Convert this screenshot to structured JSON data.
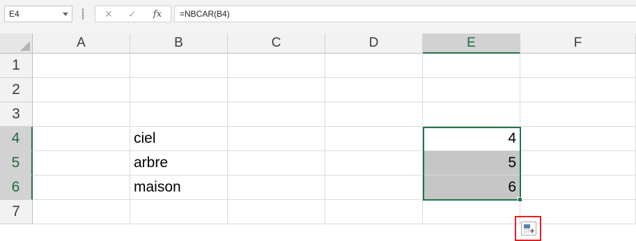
{
  "name_box": {
    "value": "E4"
  },
  "formula_bar": {
    "cancel_glyph": "✕",
    "enter_glyph": "✓",
    "fx_label": "fx",
    "formula": "=NBCAR(B4)"
  },
  "columns": [
    "A",
    "B",
    "C",
    "D",
    "E",
    "F"
  ],
  "rows": [
    "1",
    "2",
    "3",
    "4",
    "5",
    "6",
    "7"
  ],
  "selected_column": "E",
  "selected_rows": [
    "4",
    "5",
    "6"
  ],
  "cells": {
    "B4": "ciel",
    "B5": "arbre",
    "B6": "maison",
    "E4": "4",
    "E5": "5",
    "E6": "6"
  },
  "active_cell": "E4",
  "selection_range": "E4:E6",
  "colors": {
    "accent_green": "#217346",
    "selection_fill": "#c6c6c6",
    "highlight_red": "#e02020"
  },
  "icons": {
    "quick_analysis": "quick-analysis-icon",
    "fill_handle": "fill-handle"
  }
}
